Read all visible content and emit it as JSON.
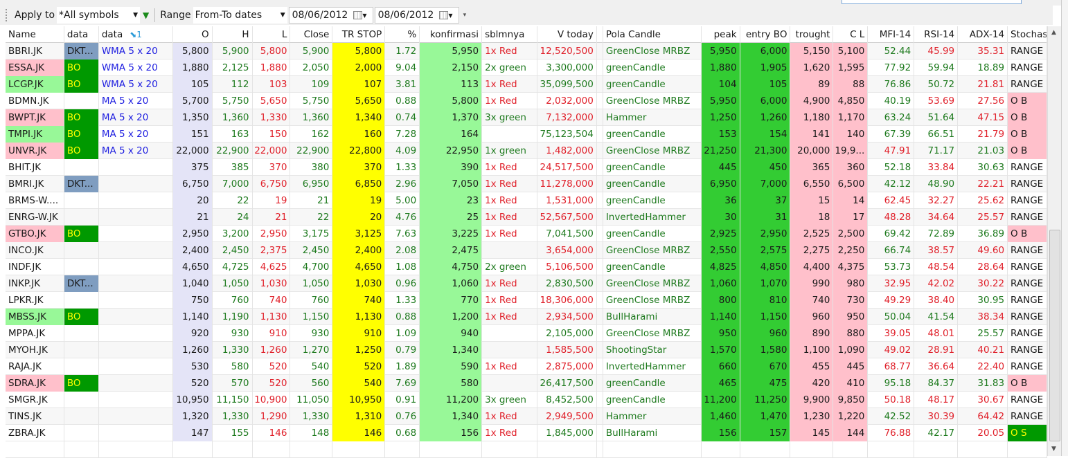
{
  "toolbar": {
    "apply_label": "Apply to",
    "apply_value": "*All symbols",
    "range_label": "Range",
    "range_value": "From-To dates",
    "date_from": "08/06/2012",
    "date_to": "08/06/2012"
  },
  "colors": {
    "lavender": "#e4e4f7",
    "yellow": "#ffff00",
    "lightgreen": "#98f898",
    "green": "#33cc33",
    "pink": "#ffc0cb",
    "bo": "#009900",
    "dkt": "#7f9dc0"
  },
  "columns": [
    "Name",
    "data",
    "data",
    "O",
    "H",
    "L",
    "Close",
    "TR STOP",
    "%",
    "konfirmasi",
    "sblmnya",
    "V today",
    "",
    "Pola Candle",
    "peak",
    "entry BO",
    "trought",
    "C L",
    "MFI-14",
    "RSI-14",
    "ADX-14",
    "Stochas"
  ],
  "sort_indicator": "1",
  "rows": [
    [
      "BBRI.JK",
      "",
      "DKT...",
      "WMA 5 x 20",
      "5,800",
      "5,900",
      "5,800",
      "5,900",
      "5,800",
      "1.72",
      "5,950",
      "1x Red",
      "12,520,500",
      "R",
      "GreenClose MRBZ",
      "5,950",
      "6,000",
      "5,150",
      "5,100",
      "52.44",
      "G",
      "45.99",
      "R",
      "35.31",
      "R",
      "RANGE"
    ],
    [
      "ESSA.JK",
      "pink",
      "BO",
      "WMA 5 x 20",
      "1,880",
      "2,125",
      "1,880",
      "2,050",
      "2,000",
      "9.04",
      "2,150",
      "2x green",
      "3,300,000",
      "G",
      "greenCandle",
      "1,880",
      "1,905",
      "1,620",
      "1,595",
      "77.92",
      "G",
      "59.94",
      "G",
      "18.89",
      "G",
      "RANGE"
    ],
    [
      "LCGP.JK",
      "green",
      "BO",
      "WMA 5 x 20",
      "105",
      "112",
      "103",
      "109",
      "107",
      "3.81",
      "113",
      "1x Red",
      "35,099,500",
      "G",
      "greenCandle",
      "104",
      "105",
      "89",
      "88",
      "76.86",
      "G",
      "50.72",
      "G",
      "21.81",
      "R",
      "RANGE"
    ],
    [
      "BDMN.JK",
      "",
      "",
      "MA 5 x 20",
      "5,700",
      "5,750",
      "5,650",
      "5,750",
      "5,650",
      "0.88",
      "5,800",
      "1x Red",
      "2,032,000",
      "R",
      "GreenClose MRBZ",
      "5,950",
      "6,000",
      "4,900",
      "4,850",
      "40.19",
      "G",
      "53.69",
      "R",
      "27.56",
      "R",
      "O B"
    ],
    [
      "BWPT.JK",
      "pink",
      "BO",
      "MA 5 x 20",
      "1,350",
      "1,360",
      "1,330",
      "1,360",
      "1,340",
      "0.74",
      "1,370",
      "3x green",
      "7,132,000",
      "R",
      "Hammer",
      "1,250",
      "1,260",
      "1,180",
      "1,170",
      "63.24",
      "G",
      "51.64",
      "G",
      "47.15",
      "R",
      "O B"
    ],
    [
      "TMPI.JK",
      "green",
      "BO",
      "MA 5 x 20",
      "151",
      "163",
      "150",
      "162",
      "160",
      "7.28",
      "164",
      "",
      "75,123,504",
      "G",
      "greenCandle",
      "153",
      "154",
      "141",
      "140",
      "67.39",
      "G",
      "66.51",
      "G",
      "21.79",
      "R",
      "O B"
    ],
    [
      "UNVR.JK",
      "pink",
      "BO",
      "MA 5 x 20",
      "22,000",
      "22,900",
      "22,000",
      "22,900",
      "22,800",
      "4.09",
      "22,950",
      "1x green",
      "1,482,000",
      "R",
      "GreenClose MRBZ",
      "21,250",
      "21,300",
      "20,000",
      "19,9...",
      "47.91",
      "R",
      "71.17",
      "G",
      "21.03",
      "G",
      "O B"
    ],
    [
      "BHIT.JK",
      "",
      "",
      "",
      "375",
      "385",
      "370",
      "380",
      "370",
      "1.33",
      "390",
      "1x Red",
      "24,517,500",
      "R",
      "greenCandle",
      "445",
      "450",
      "365",
      "360",
      "52.18",
      "G",
      "33.84",
      "R",
      "30.63",
      "G",
      "RANGE"
    ],
    [
      "BMRI.JK",
      "",
      "DKT...",
      "",
      "6,750",
      "7,000",
      "6,750",
      "6,950",
      "6,850",
      "2.96",
      "7,050",
      "1x Red",
      "11,278,000",
      "R",
      "greenCandle",
      "6,950",
      "7,000",
      "6,550",
      "6,500",
      "42.12",
      "G",
      "48.90",
      "G",
      "22.21",
      "R",
      "RANGE"
    ],
    [
      "BRMS-W....",
      "",
      "",
      "",
      "20",
      "22",
      "19",
      "21",
      "19",
      "5.00",
      "23",
      "1x Red",
      "1,531,000",
      "R",
      "greenCandle",
      "36",
      "37",
      "15",
      "14",
      "62.45",
      "R",
      "32.27",
      "R",
      "25.62",
      "R",
      "RANGE"
    ],
    [
      "ENRG-W.JK",
      "",
      "",
      "",
      "21",
      "24",
      "21",
      "22",
      "20",
      "4.76",
      "25",
      "1x Red",
      "52,567,500",
      "R",
      "InvertedHammer",
      "30",
      "31",
      "18",
      "17",
      "48.28",
      "R",
      "34.64",
      "R",
      "25.57",
      "R",
      "RANGE"
    ],
    [
      "GTBO.JK",
      "pink",
      "BO",
      "",
      "2,950",
      "3,200",
      "2,950",
      "3,175",
      "3,125",
      "7.63",
      "3,225",
      "1x Red",
      "7,041,500",
      "G",
      "greenCandle",
      "2,925",
      "2,950",
      "2,525",
      "2,500",
      "69.42",
      "G",
      "72.89",
      "G",
      "36.89",
      "G",
      "O B"
    ],
    [
      "INCO.JK",
      "",
      "",
      "",
      "2,400",
      "2,450",
      "2,375",
      "2,450",
      "2,400",
      "2.08",
      "2,475",
      "",
      "3,654,000",
      "R",
      "GreenClose MRBZ",
      "2,550",
      "2,575",
      "2,275",
      "2,250",
      "66.74",
      "G",
      "38.57",
      "R",
      "49.60",
      "R",
      "RANGE"
    ],
    [
      "INDF.JK",
      "",
      "",
      "",
      "4,650",
      "4,725",
      "4,625",
      "4,700",
      "4,650",
      "1.08",
      "4,750",
      "2x green",
      "5,106,500",
      "R",
      "greenCandle",
      "4,825",
      "4,850",
      "4,400",
      "4,375",
      "53.73",
      "G",
      "48.54",
      "R",
      "28.64",
      "R",
      "RANGE"
    ],
    [
      "INKP.JK",
      "",
      "DKT...",
      "",
      "1,040",
      "1,050",
      "1,030",
      "1,050",
      "1,030",
      "0.96",
      "1,060",
      "1x Red",
      "2,830,500",
      "G",
      "GreenClose MRBZ",
      "1,060",
      "1,070",
      "990",
      "980",
      "32.95",
      "R",
      "42.02",
      "R",
      "30.22",
      "R",
      "RANGE"
    ],
    [
      "LPKR.JK",
      "",
      "",
      "",
      "750",
      "760",
      "740",
      "760",
      "740",
      "1.33",
      "770",
      "1x Red",
      "18,306,000",
      "R",
      "GreenClose MRBZ",
      "800",
      "810",
      "740",
      "730",
      "49.29",
      "R",
      "38.40",
      "R",
      "30.95",
      "G",
      "RANGE"
    ],
    [
      "MBSS.JK",
      "green",
      "BO",
      "",
      "1,140",
      "1,190",
      "1,130",
      "1,150",
      "1,130",
      "0.88",
      "1,200",
      "1x Red",
      "2,934,500",
      "R",
      "BullHarami",
      "1,140",
      "1,150",
      "960",
      "950",
      "50.04",
      "G",
      "41.54",
      "G",
      "38.34",
      "R",
      "RANGE"
    ],
    [
      "MPPA.JK",
      "",
      "",
      "",
      "920",
      "930",
      "910",
      "930",
      "910",
      "1.09",
      "940",
      "",
      "2,105,000",
      "G",
      "GreenClose MRBZ",
      "950",
      "960",
      "890",
      "880",
      "39.05",
      "R",
      "48.01",
      "R",
      "25.57",
      "G",
      "RANGE"
    ],
    [
      "MYOH.JK",
      "",
      "",
      "",
      "1,260",
      "1,330",
      "1,260",
      "1,270",
      "1,250",
      "0.79",
      "1,340",
      "",
      "1,585,500",
      "R",
      "ShootingStar",
      "1,570",
      "1,580",
      "1,100",
      "1,090",
      "49.02",
      "R",
      "28.91",
      "R",
      "40.21",
      "R",
      "RANGE"
    ],
    [
      "RAJA.JK",
      "",
      "",
      "",
      "530",
      "580",
      "520",
      "540",
      "520",
      "1.89",
      "590",
      "1x Red",
      "2,875,000",
      "R",
      "InvertedHammer",
      "660",
      "670",
      "455",
      "445",
      "68.77",
      "R",
      "36.64",
      "R",
      "22.40",
      "R",
      "RANGE"
    ],
    [
      "SDRA.JK",
      "pink",
      "BO",
      "",
      "520",
      "570",
      "520",
      "560",
      "540",
      "7.69",
      "580",
      "",
      "26,417,500",
      "G",
      "greenCandle",
      "465",
      "475",
      "420",
      "410",
      "95.18",
      "G",
      "84.37",
      "G",
      "31.83",
      "G",
      "O B"
    ],
    [
      "SMGR.JK",
      "",
      "",
      "",
      "10,950",
      "11,150",
      "10,900",
      "11,050",
      "10,950",
      "0.91",
      "11,200",
      "3x green",
      "8,452,500",
      "G",
      "greenCandle",
      "11,200",
      "11,250",
      "9,900",
      "9,850",
      "50.18",
      "R",
      "48.17",
      "R",
      "30.67",
      "R",
      "RANGE"
    ],
    [
      "TINS.JK",
      "",
      "",
      "",
      "1,320",
      "1,330",
      "1,290",
      "1,330",
      "1,310",
      "0.76",
      "1,340",
      "1x Red",
      "2,949,500",
      "R",
      "Hammer",
      "1,460",
      "1,470",
      "1,230",
      "1,220",
      "42.52",
      "G",
      "30.39",
      "R",
      "64.42",
      "R",
      "RANGE"
    ],
    [
      "ZBRA.JK",
      "",
      "",
      "",
      "147",
      "155",
      "146",
      "148",
      "146",
      "0.68",
      "156",
      "1x Red",
      "1,845,000",
      "G",
      "BullHarami",
      "156",
      "157",
      "145",
      "144",
      "76.88",
      "R",
      "42.17",
      "G",
      "20.05",
      "R",
      "O S"
    ]
  ]
}
